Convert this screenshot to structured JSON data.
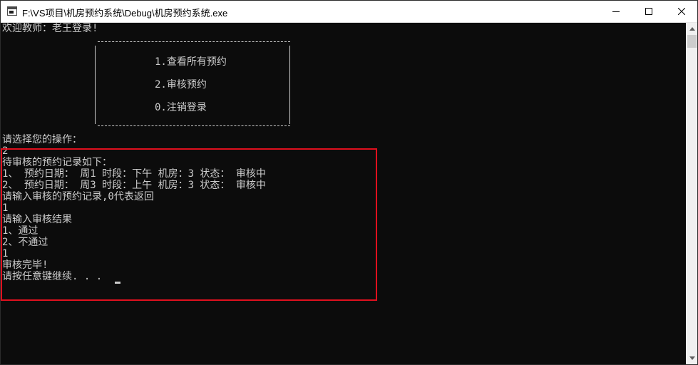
{
  "window": {
    "title": "F:\\VS项目\\机房预约系统\\Debug\\机房预约系统.exe"
  },
  "console": {
    "welcome": "欢迎教师：老王登录!",
    "menu": {
      "items": [
        "1.查看所有预约",
        "2.审核预约",
        "0.注销登录"
      ]
    },
    "lines": [
      "请选择您的操作：",
      "2",
      "待审核的预约记录如下：",
      "1、 预约日期： 周1 时段：下午 机房：3 状态： 审核中",
      "2、 预约日期： 周3 时段：上午 机房：3 状态： 审核中",
      "请输入审核的预约记录,0代表返回",
      "1",
      "请输入审核结果",
      "1、通过",
      "2、不通过",
      "1",
      "审核完毕!",
      "请按任意键继续. . ."
    ]
  },
  "colors": {
    "console_bg": "#0c0c0c",
    "console_text": "#cccccc",
    "highlight": "#e0101e"
  },
  "icons": {
    "app": "console-app-icon",
    "minimize": "minimize-icon",
    "maximize": "maximize-icon",
    "close": "close-icon"
  }
}
